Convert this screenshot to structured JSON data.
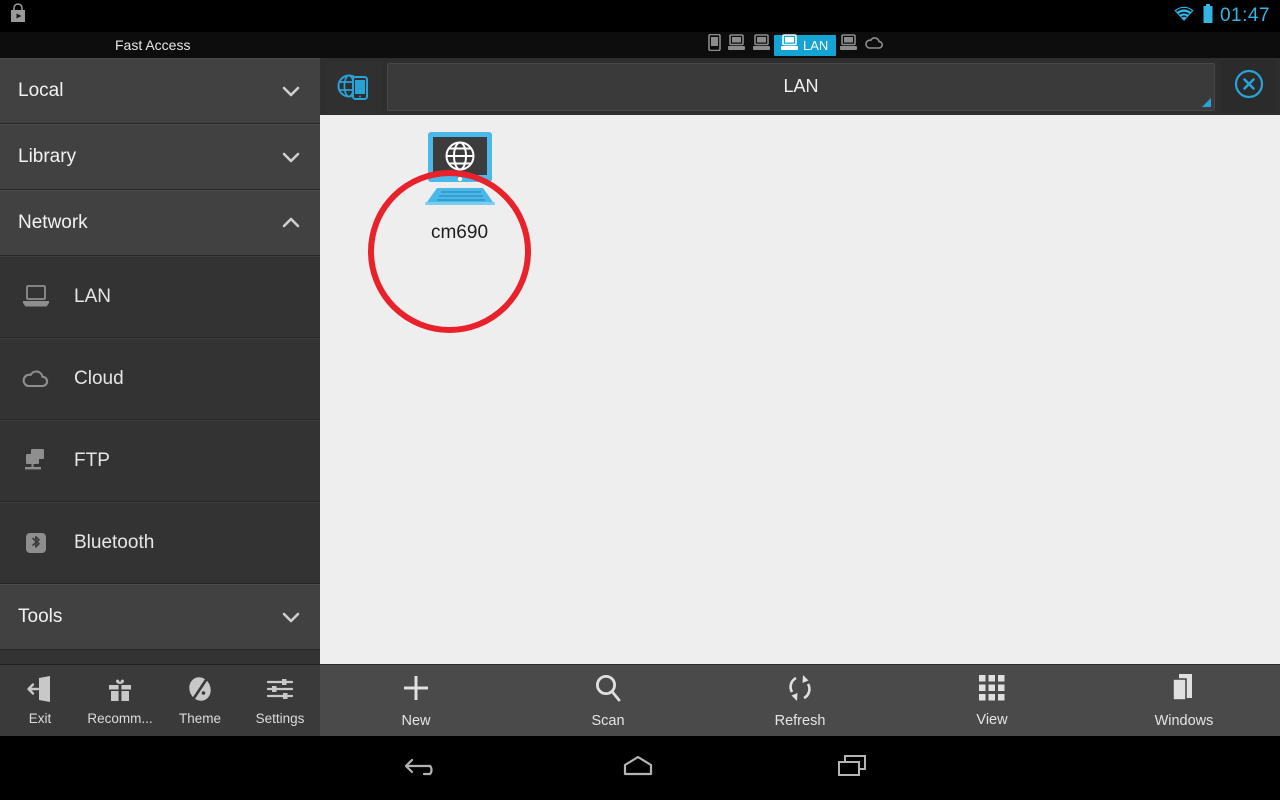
{
  "statusbar": {
    "play_icon": "play-store-bag-icon",
    "wifi_icon": "wifi-icon",
    "battery_icon": "battery-icon",
    "clock": "01:47",
    "accent_color": "#33b5e5"
  },
  "fastbar": {
    "title": "Fast Access",
    "tabs": [
      {
        "icon": "phone-icon",
        "label": "",
        "active": false
      },
      {
        "icon": "computer-icon",
        "label": "",
        "active": false
      },
      {
        "icon": "computer-icon",
        "label": "",
        "active": false
      },
      {
        "icon": "computer-icon",
        "label": "LAN",
        "active": true
      },
      {
        "icon": "computer-icon",
        "label": "",
        "active": false
      },
      {
        "icon": "cloud-icon",
        "label": "",
        "active": false
      }
    ],
    "active_tab_color": "#14a3d4"
  },
  "sidebar": {
    "sections": [
      {
        "label": "Local",
        "chevron": "chevron-down-icon"
      },
      {
        "label": "Library",
        "chevron": "chevron-down-icon"
      },
      {
        "label": "Network",
        "chevron": "chevron-up-icon"
      }
    ],
    "network_items": [
      {
        "label": "LAN",
        "icon": "laptop-icon"
      },
      {
        "label": "Cloud",
        "icon": "cloud-icon"
      },
      {
        "label": "FTP",
        "icon": "ftp-server-icon"
      },
      {
        "label": "Bluetooth",
        "icon": "bluetooth-icon"
      }
    ],
    "tools_section": {
      "label": "Tools",
      "chevron": "chevron-down-icon"
    },
    "toolbar": [
      {
        "label": "Exit",
        "icon": "exit-door-icon"
      },
      {
        "label": "Recomm...",
        "icon": "gift-icon"
      },
      {
        "label": "Theme",
        "icon": "palette-icon"
      },
      {
        "label": "Settings",
        "icon": "sliders-icon"
      }
    ]
  },
  "main": {
    "addressbar": {
      "left_icon": "globe-device-icon",
      "path": "LAN",
      "resize_handle": "resize-corner-icon",
      "close_icon": "close-circle-icon",
      "accent_color": "#27a3d8"
    },
    "files": [
      {
        "name": "cm690",
        "icon": "network-computer-icon",
        "highlighted": true
      }
    ],
    "annotation": {
      "shape": "circle",
      "color": "#e8212b"
    },
    "toolbar": [
      {
        "label": "New",
        "icon": "plus-icon"
      },
      {
        "label": "Scan",
        "icon": "search-icon"
      },
      {
        "label": "Refresh",
        "icon": "refresh-icon"
      },
      {
        "label": "View",
        "icon": "grid-icon"
      },
      {
        "label": "Windows",
        "icon": "windows-stack-icon"
      }
    ]
  },
  "navbar": {
    "buttons": [
      {
        "name": "back",
        "icon": "back-arrow-icon"
      },
      {
        "name": "home",
        "icon": "home-icon"
      },
      {
        "name": "recents",
        "icon": "recents-icon"
      }
    ]
  }
}
